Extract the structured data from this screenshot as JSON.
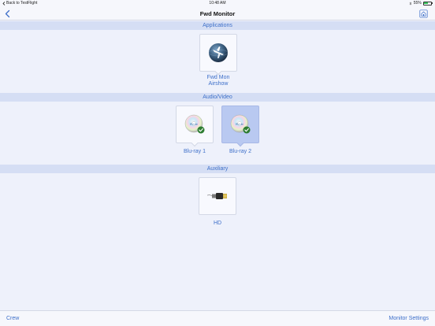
{
  "status_bar": {
    "back_label": "Back to TestFlight",
    "time": "10:48 AM",
    "battery_percent": "55%",
    "battery_level": 0.55
  },
  "nav": {
    "title": "Fwd Monitor",
    "back_icon": "chevron-left-icon",
    "action_icon": "home-icon"
  },
  "sections": {
    "applications": {
      "header": "Applications",
      "items": [
        {
          "label_line1": "Fwd Mon",
          "label_line2": "Airshow",
          "icon": "airshow-globe-icon",
          "selected": false
        }
      ]
    },
    "audio_video": {
      "header": "Audio/Video",
      "items": [
        {
          "label": "Blu-ray 1",
          "icon": "bluray-disc-icon",
          "selected": false
        },
        {
          "label": "Blu-ray 2",
          "icon": "bluray-disc-icon",
          "selected": true
        }
      ]
    },
    "auxiliary": {
      "header": "Auxiliary",
      "items": [
        {
          "label": "HD",
          "icon": "hdmi-connector-icon",
          "selected": false
        }
      ]
    }
  },
  "bottom_bar": {
    "left_label": "Crew",
    "right_label": "Monitor Settings"
  },
  "colors": {
    "accent": "#3d6fc9",
    "section_bg": "#d5def4",
    "selected_tile": "#b9c9f1",
    "background": "#eef1fb",
    "check_green": "#2e7d32"
  }
}
